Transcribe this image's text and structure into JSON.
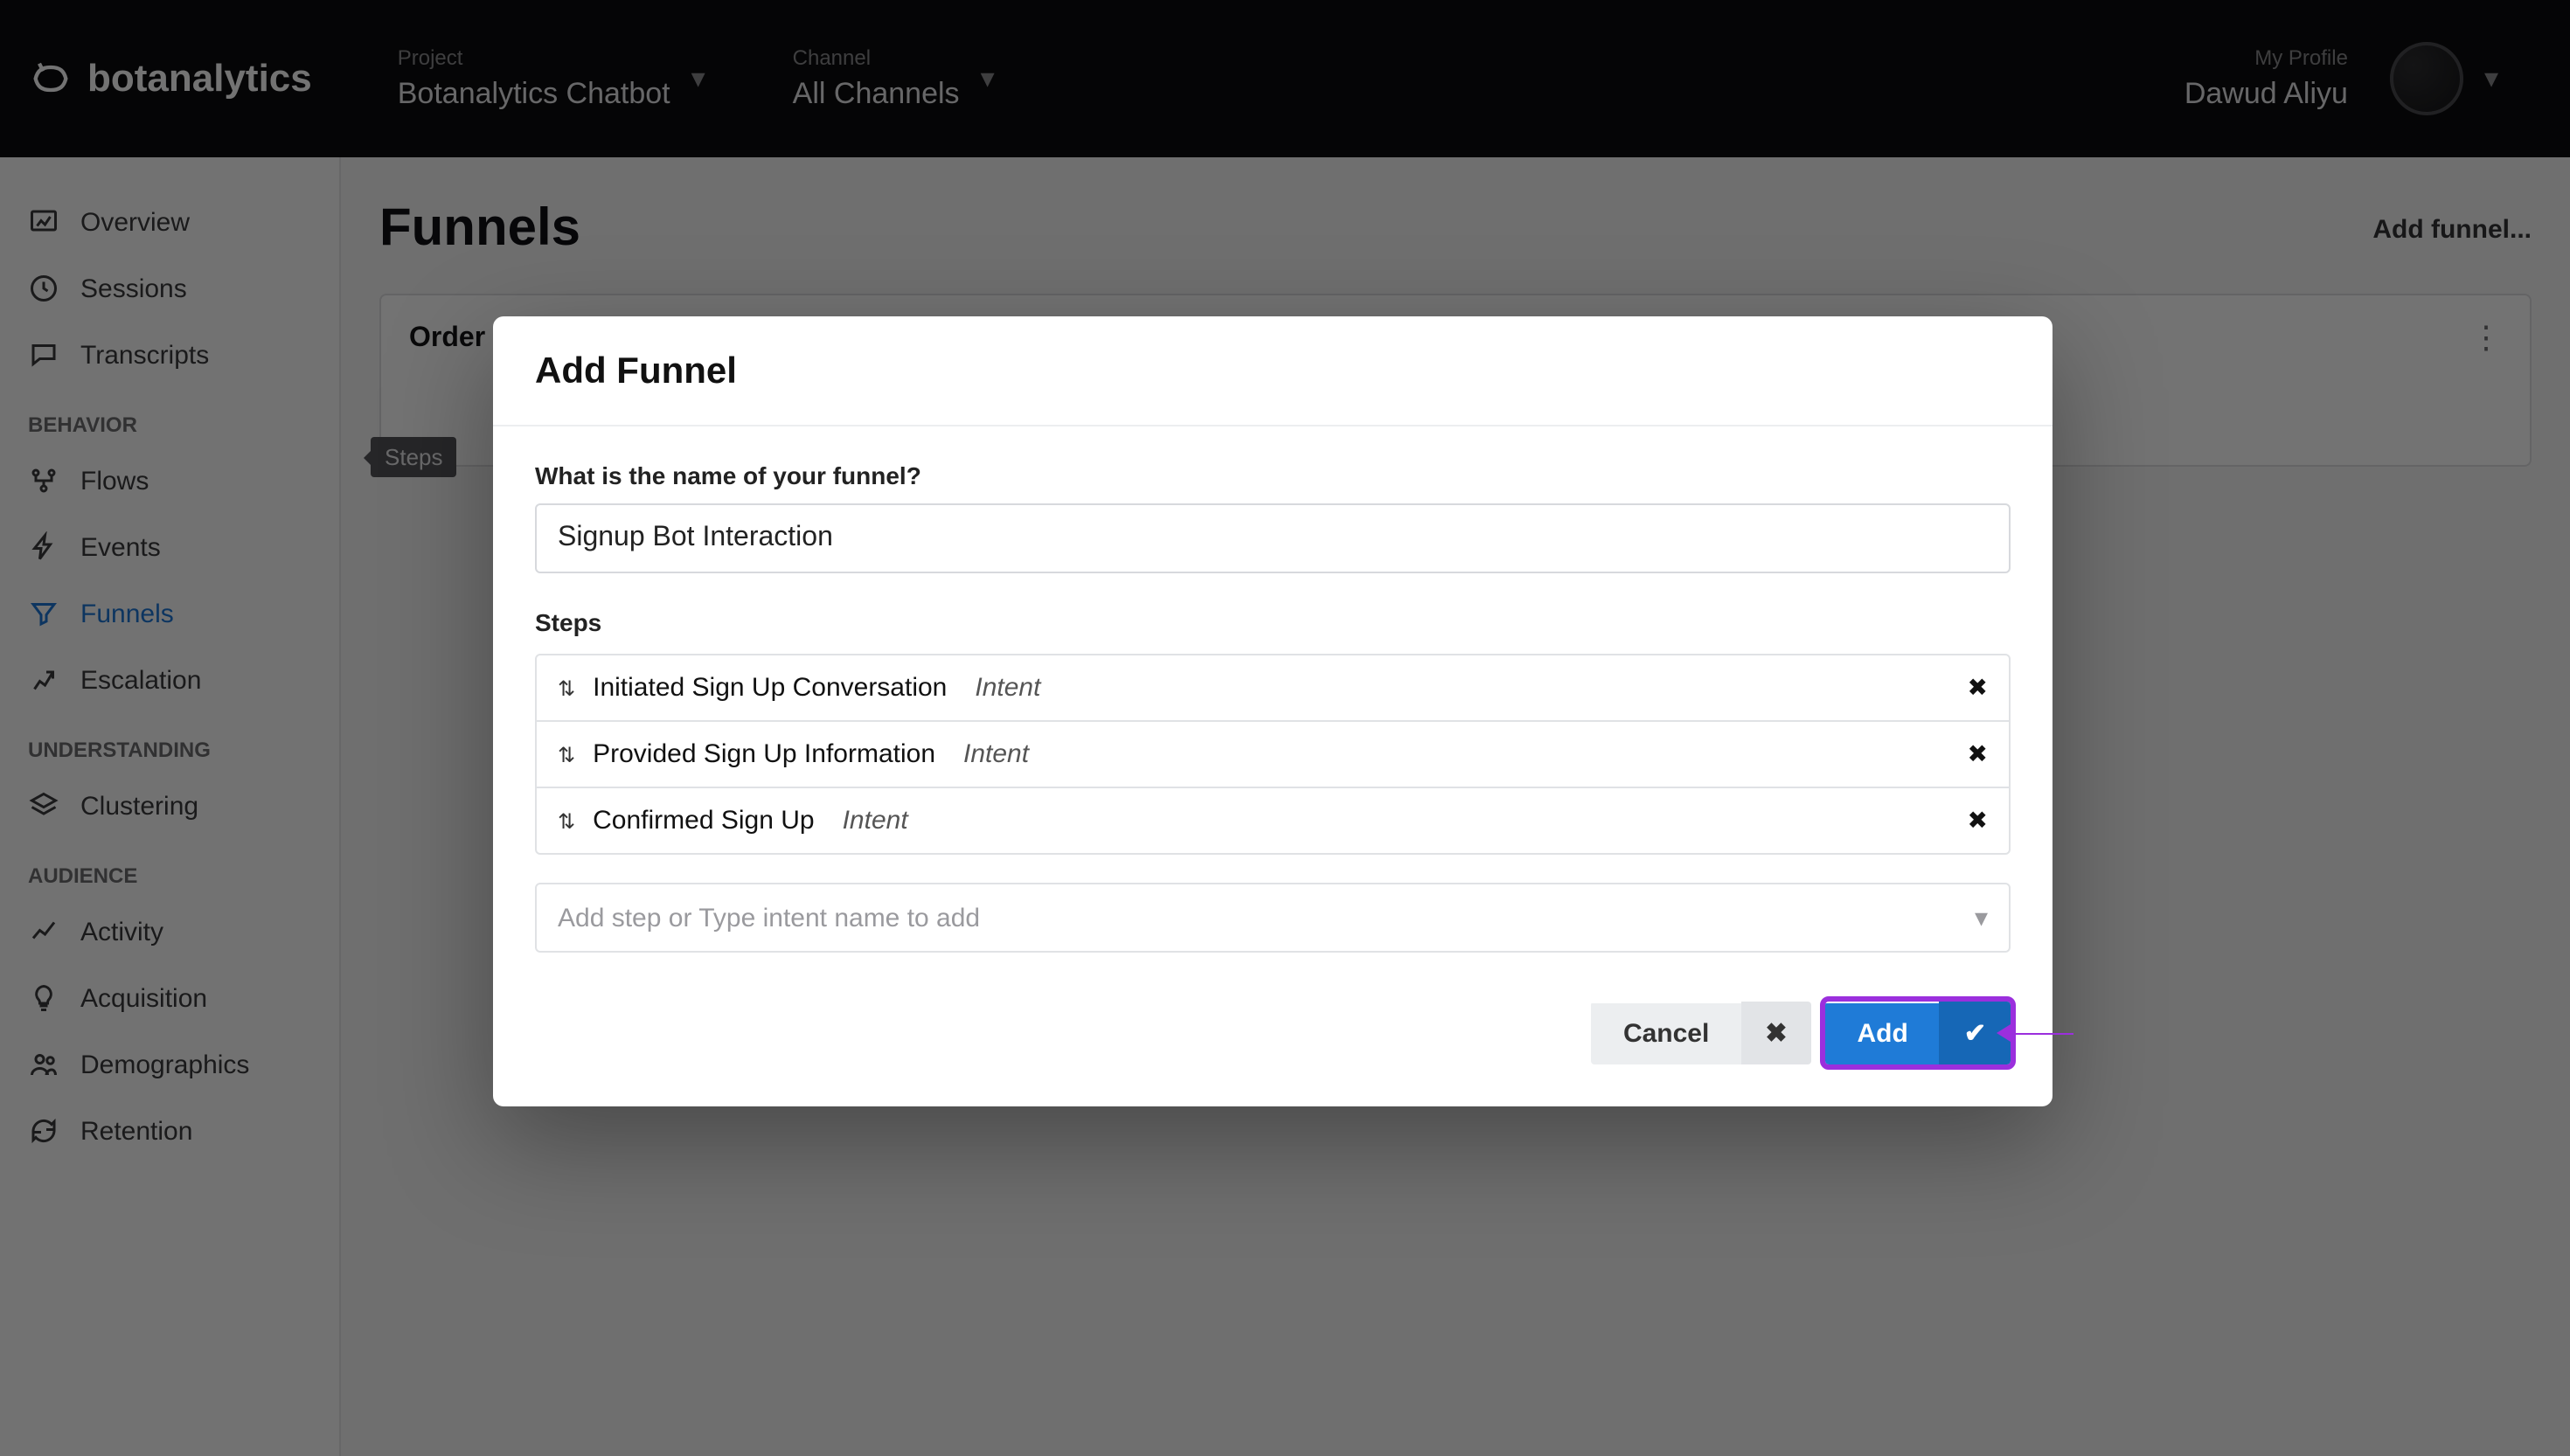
{
  "logo_text": "botanalytics",
  "topbar": {
    "project_label": "Project",
    "project_value": "Botanalytics Chatbot",
    "channel_label": "Channel",
    "channel_value": "All Channels",
    "profile_label": "My Profile",
    "profile_value": "Dawud Aliyu"
  },
  "sidebar": {
    "items_top": [
      {
        "label": "Overview",
        "icon": "overview"
      },
      {
        "label": "Sessions",
        "icon": "clock"
      },
      {
        "label": "Transcripts",
        "icon": "chat"
      }
    ],
    "group_behavior": "BEHAVIOR",
    "items_behavior": [
      {
        "label": "Flows",
        "icon": "flows"
      },
      {
        "label": "Events",
        "icon": "bolt"
      },
      {
        "label": "Funnels",
        "icon": "funnel",
        "active": true
      },
      {
        "label": "Escalation",
        "icon": "escalation"
      }
    ],
    "group_understanding": "UNDERSTANDING",
    "items_understanding": [
      {
        "label": "Clustering",
        "icon": "layers"
      }
    ],
    "group_audience": "AUDIENCE",
    "items_audience": [
      {
        "label": "Activity",
        "icon": "trend"
      },
      {
        "label": "Acquisition",
        "icon": "bulb"
      },
      {
        "label": "Demographics",
        "icon": "people"
      },
      {
        "label": "Retention",
        "icon": "refresh"
      }
    ]
  },
  "page": {
    "title": "Funnels",
    "add_funnel_link": "Add funnel...",
    "existing_funnel_title": "Order",
    "steps_tag": "Steps"
  },
  "modal": {
    "title": "Add Funnel",
    "name_label": "What is the name of your funnel?",
    "name_value": "Signup Bot Interaction",
    "steps_label": "Steps",
    "steps": [
      {
        "name": "Initiated Sign Up Conversation",
        "kind": "Intent"
      },
      {
        "name": "Provided Sign Up Information",
        "kind": "Intent"
      },
      {
        "name": "Confirmed Sign Up",
        "kind": "Intent"
      }
    ],
    "add_step_placeholder": "Add step or Type intent name to add",
    "cancel_label": "Cancel",
    "add_label": "Add"
  }
}
